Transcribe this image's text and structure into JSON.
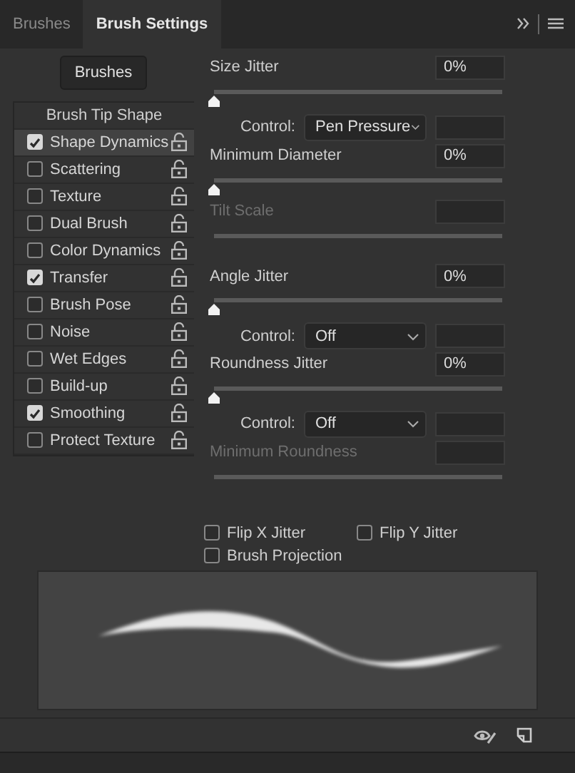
{
  "tabs": [
    {
      "label": "Brushes",
      "selected": false
    },
    {
      "label": "Brush Settings",
      "selected": true
    }
  ],
  "brushes_button": "Brushes",
  "options": [
    {
      "kind": "header",
      "label": "Brush Tip Shape"
    },
    {
      "kind": "option",
      "label": "Shape Dynamics",
      "checked": true,
      "selected": true
    },
    {
      "kind": "option",
      "label": "Scattering",
      "checked": false,
      "selected": false
    },
    {
      "kind": "option",
      "label": "Texture",
      "checked": false,
      "selected": false
    },
    {
      "kind": "option",
      "label": "Dual Brush",
      "checked": false,
      "selected": false
    },
    {
      "kind": "option",
      "label": "Color Dynamics",
      "checked": false,
      "selected": false
    },
    {
      "kind": "option",
      "label": "Transfer",
      "checked": true,
      "selected": false
    },
    {
      "kind": "option",
      "label": "Brush Pose",
      "checked": false,
      "selected": false
    },
    {
      "kind": "option",
      "label": "Noise",
      "checked": false,
      "selected": false
    },
    {
      "kind": "option",
      "label": "Wet Edges",
      "checked": false,
      "selected": false
    },
    {
      "kind": "option",
      "label": "Build-up",
      "checked": false,
      "selected": false
    },
    {
      "kind": "option",
      "label": "Smoothing",
      "checked": true,
      "selected": false
    },
    {
      "kind": "option",
      "label": "Protect Texture",
      "checked": false,
      "selected": false
    }
  ],
  "settings": [
    {
      "kind": "slider",
      "label": "Size Jitter",
      "value": "0%",
      "level": 0,
      "disabled": false
    },
    {
      "kind": "control",
      "label": "Control:",
      "value": "Pen Pressure"
    },
    {
      "kind": "slider",
      "label": "Minimum Diameter",
      "value": "0%",
      "level": 0,
      "disabled": false
    },
    {
      "kind": "slider",
      "label": "Tilt Scale",
      "disabled": true
    },
    {
      "kind": "slider",
      "label": "Angle Jitter",
      "value": "0%",
      "level": 0,
      "disabled": false
    },
    {
      "kind": "control",
      "label": "Control:",
      "value": "Off"
    },
    {
      "kind": "slider",
      "label": "Roundness Jitter",
      "value": "0%",
      "level": 0,
      "disabled": false
    },
    {
      "kind": "control",
      "label": "Control:",
      "value": "Off"
    },
    {
      "kind": "slider",
      "label": "Minimum Roundness",
      "disabled": true
    }
  ],
  "flips": [
    {
      "label": "Flip X Jitter",
      "checked": false
    },
    {
      "label": "Flip Y Jitter",
      "checked": false
    },
    {
      "label": "Brush Projection",
      "checked": false
    }
  ],
  "preview": {
    "kind": "stroke"
  }
}
